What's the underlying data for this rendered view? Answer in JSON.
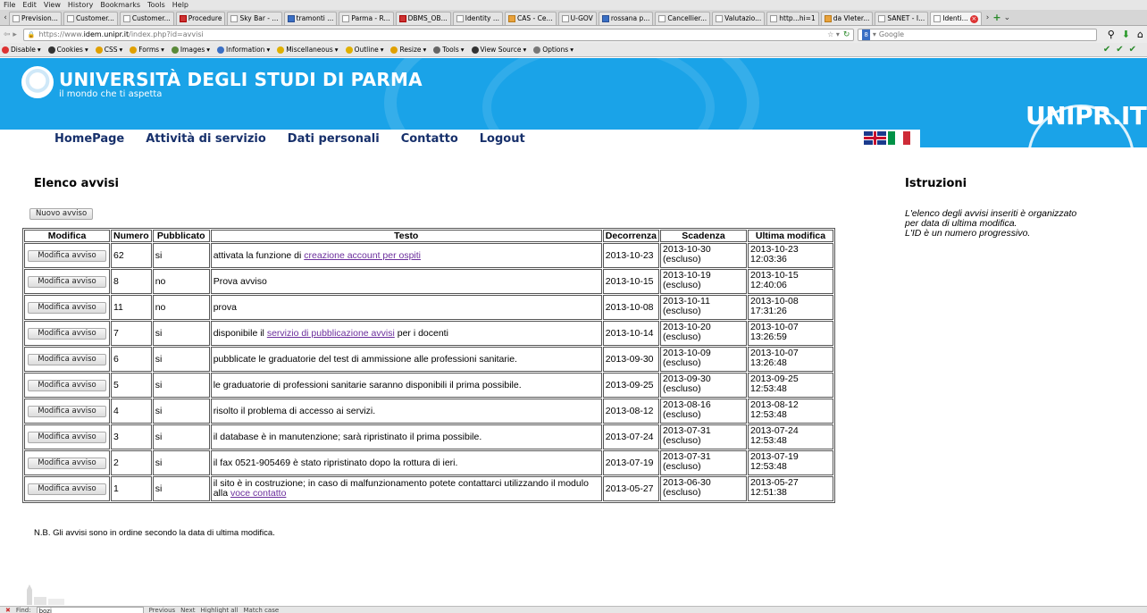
{
  "browser": {
    "menu": [
      "File",
      "Edit",
      "View",
      "History",
      "Bookmarks",
      "Tools",
      "Help"
    ],
    "tabs": [
      {
        "label": "Prevision...",
        "icon": "page"
      },
      {
        "label": "Customer...",
        "icon": "page"
      },
      {
        "label": "Customer...",
        "icon": "page"
      },
      {
        "label": "Procedure",
        "icon": "red"
      },
      {
        "label": "Sky Bar - ...",
        "icon": "page"
      },
      {
        "label": "tramonti ...",
        "icon": "blue"
      },
      {
        "label": "Parma - R...",
        "icon": "page"
      },
      {
        "label": "DBMS_OB...",
        "icon": "red"
      },
      {
        "label": "Identity ...",
        "icon": "page"
      },
      {
        "label": "CAS - Ce...",
        "icon": "orange"
      },
      {
        "label": "U-GOV",
        "icon": "page"
      },
      {
        "label": "rossana p...",
        "icon": "blue"
      },
      {
        "label": "Cancellier...",
        "icon": "page"
      },
      {
        "label": "Valutazio...",
        "icon": "page"
      },
      {
        "label": "http...hi=1",
        "icon": "page"
      },
      {
        "label": "da Vleter...",
        "icon": "orange"
      },
      {
        "label": "SANET - I...",
        "icon": "page"
      },
      {
        "label": "Identi...",
        "icon": "page",
        "active": true
      }
    ],
    "url": {
      "prefix": "https://www.",
      "host": "idem.unipr.it",
      "rest": "/index.php?id=avvisi"
    },
    "search_placeholder": "Google",
    "search_engine_badge": "8",
    "toolbar": [
      "Disable",
      "Cookies",
      "CSS",
      "Forms",
      "Images",
      "Information",
      "Miscellaneous",
      "Outline",
      "Resize",
      "Tools",
      "View Source",
      "Options"
    ],
    "find": {
      "label": "Find:",
      "value": "bozi",
      "next": "Next",
      "prev": "Previous",
      "highlight": "Highlight all",
      "match": "Match case"
    }
  },
  "header": {
    "title": "UNIVERSITÀ DEGLI STUDI DI PARMA",
    "tagline": "il mondo che ti aspetta",
    "logo_text": "UNIPR.IT",
    "nav": [
      "HomePage",
      "Attività di servizio",
      "Dati personali",
      "Contatto",
      "Logout"
    ],
    "colors": {
      "banner": "#1aa3e8",
      "nav_text": "#17306b"
    }
  },
  "main": {
    "title": "Elenco avvisi",
    "new_button": "Nuovo avviso",
    "columns": [
      "Modifica",
      "Numero",
      "Pubblicato",
      "Testo",
      "Decorrenza",
      "Scadenza",
      "Ultima modifica"
    ],
    "edit_button": "Modifica avviso",
    "rows": [
      {
        "num": "62",
        "pub": "si",
        "text_before": "attivata la funzione di ",
        "link": "creazione account per ospiti",
        "text_after": "",
        "dec": "2013-10-23",
        "sca_date": "2013-10-30",
        "sca_note": "(escluso)",
        "ult_date": "2013-10-23",
        "ult_time": "12:03:36"
      },
      {
        "num": "8",
        "pub": "no",
        "text_before": "Prova avviso",
        "link": "",
        "text_after": "",
        "dec": "2013-10-15",
        "sca_date": "2013-10-19",
        "sca_note": "(escluso)",
        "ult_date": "2013-10-15",
        "ult_time": "12:40:06"
      },
      {
        "num": "11",
        "pub": "no",
        "text_before": "prova",
        "link": "",
        "text_after": "",
        "dec": "2013-10-08",
        "sca_date": "2013-10-11",
        "sca_note": "(escluso)",
        "ult_date": "2013-10-08",
        "ult_time": "17:31:26"
      },
      {
        "num": "7",
        "pub": "si",
        "text_before": "disponibile il ",
        "link": "servizio di pubblicazione avvisi",
        "text_after": " per i docenti",
        "dec": "2013-10-14",
        "sca_date": "2013-10-20",
        "sca_note": "(escluso)",
        "ult_date": "2013-10-07",
        "ult_time": "13:26:59"
      },
      {
        "num": "6",
        "pub": "si",
        "text_before": "pubblicate le graduatorie del test di ammissione alle professioni sanitarie.",
        "link": "",
        "text_after": "",
        "dec": "2013-09-30",
        "sca_date": "2013-10-09",
        "sca_note": "(escluso)",
        "ult_date": "2013-10-07",
        "ult_time": "13:26:48"
      },
      {
        "num": "5",
        "pub": "si",
        "text_before": "le graduatorie di professioni sanitarie saranno disponibili il prima possibile.",
        "link": "",
        "text_after": "",
        "dec": "2013-09-25",
        "sca_date": "2013-09-30",
        "sca_note": "(escluso)",
        "ult_date": "2013-09-25",
        "ult_time": "12:53:48"
      },
      {
        "num": "4",
        "pub": "si",
        "text_before": "risolto il problema di accesso ai servizi.",
        "link": "",
        "text_after": "",
        "dec": "2013-08-12",
        "sca_date": "2013-08-16",
        "sca_note": "(escluso)",
        "ult_date": "2013-08-12",
        "ult_time": "12:53:48"
      },
      {
        "num": "3",
        "pub": "si",
        "text_before": "il database è in manutenzione; sarà ripristinato il prima possibile.",
        "link": "",
        "text_after": "",
        "dec": "2013-07-24",
        "sca_date": "2013-07-31",
        "sca_note": "(escluso)",
        "ult_date": "2013-07-24",
        "ult_time": "12:53:48"
      },
      {
        "num": "2",
        "pub": "si",
        "text_before": "il fax 0521-905469 è stato ripristinato dopo la rottura di ieri.",
        "link": "",
        "text_after": "",
        "dec": "2013-07-19",
        "sca_date": "2013-07-31",
        "sca_note": "(escluso)",
        "ult_date": "2013-07-19",
        "ult_time": "12:53:48"
      },
      {
        "num": "1",
        "pub": "si",
        "text_before": "il sito è in costruzione; in caso di malfunzionamento potete contattarci utilizzando il modulo alla ",
        "link": "voce contatto",
        "text_after": "",
        "dec": "2013-05-27",
        "sca_date": "2013-06-30",
        "sca_note": "(escluso)",
        "ult_date": "2013-05-27",
        "ult_time": "12:51:38"
      }
    ],
    "footnote": "N.B. Gli avvisi sono in ordine secondo la data di ultima modifica."
  },
  "sidebar": {
    "title": "Istruzioni",
    "lines": [
      "L'elenco degli avvisi inseriti è organizzato",
      "per data di ultima modifica.",
      "L'ID è un numero progressivo."
    ]
  }
}
